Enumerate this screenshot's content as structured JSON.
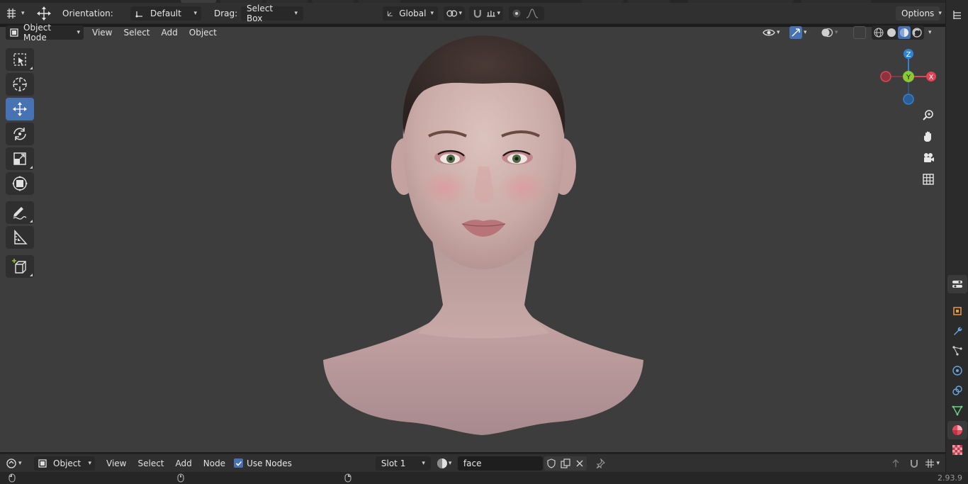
{
  "header": {
    "orientation_label": "Orientation:",
    "orientation_value": "Default",
    "drag_label": "Drag:",
    "drag_value": "Select Box",
    "transform_space": "Global",
    "options_label": "Options"
  },
  "viewport_header": {
    "mode": "Object Mode",
    "menus": [
      "View",
      "Select",
      "Add",
      "Object"
    ]
  },
  "toolbar": {
    "tools": [
      "select-box",
      "cursor",
      "move",
      "rotate",
      "scale",
      "transform",
      "annotate",
      "measure",
      "add-cube"
    ],
    "active": "move"
  },
  "gizmo": {
    "axes": {
      "z": "Z",
      "y": "Y",
      "x": "X"
    },
    "colors": {
      "x": "#e54253",
      "y": "#8bc831",
      "z": "#2f83d6"
    }
  },
  "shader_editor": {
    "object_type": "Object",
    "menus": [
      "View",
      "Select",
      "Add",
      "Node"
    ],
    "use_nodes_label": "Use Nodes",
    "use_nodes_checked": true,
    "slot": "Slot 1",
    "material_name": "face"
  },
  "status": {
    "version": "2.93.9"
  },
  "colors": {
    "accent": "#4772b3",
    "viewport_bg": "#3d3d3d",
    "panel_bg": "#303030"
  }
}
